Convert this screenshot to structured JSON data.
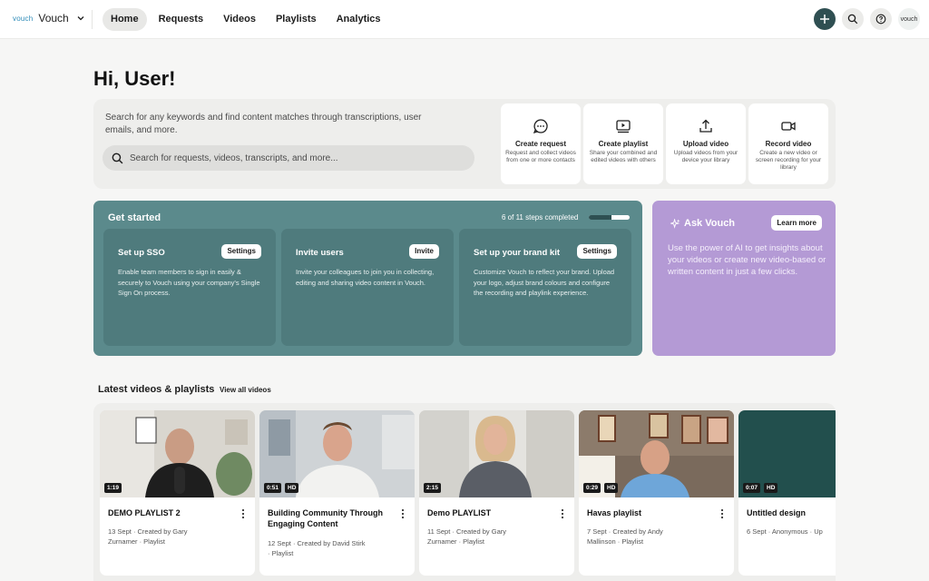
{
  "brand": {
    "logo_text": "vouch",
    "name": "Vouch"
  },
  "nav": {
    "items": [
      "Home",
      "Requests",
      "Videos",
      "Playlists",
      "Analytics"
    ],
    "active": "Home"
  },
  "user_avatar": "vouch",
  "greeting": "Hi, User!",
  "search": {
    "description": "Search for any keywords and find content matches through transcriptions, user emails, and more.",
    "placeholder": "Search for requests, videos, transcripts, and more..."
  },
  "actions": [
    {
      "title": "Create request",
      "desc": "Request and collect videos from one or more contacts",
      "icon": "chat-bubble-icon"
    },
    {
      "title": "Create playlist",
      "desc": "Share your combined and edited videos with others",
      "icon": "playlist-icon"
    },
    {
      "title": "Upload video",
      "desc": "Upload videos from your device your library",
      "icon": "upload-icon"
    },
    {
      "title": "Record video",
      "desc": "Create a new video or screen recording for your library",
      "icon": "camera-icon"
    }
  ],
  "get_started": {
    "title": "Get started",
    "progress_text": "6 of 11 steps completed",
    "progress": 0.545,
    "cards": [
      {
        "title": "Set up SSO",
        "button": "Settings",
        "desc": "Enable team members to sign in easily & securely to Vouch using your company's Single Sign On process."
      },
      {
        "title": "Invite users",
        "button": "Invite",
        "desc": "Invite your colleagues to join you in collecting, editing and sharing video content in Vouch."
      },
      {
        "title": "Set up your brand kit",
        "button": "Settings",
        "desc": "Customize Vouch to reflect your brand. Upload your logo, adjust brand colours and configure the recording and playlink experience."
      }
    ]
  },
  "ask_vouch": {
    "title": "Ask Vouch",
    "button": "Learn more",
    "desc": "Use the power of AI to get insights about your videos or create new video-based or written content in just a few clicks."
  },
  "latest": {
    "title": "Latest videos & playlists",
    "view_all": "View all videos",
    "videos": [
      {
        "title": "DEMO PLAYLIST 2",
        "meta1": "13 Sept · Created by Gary",
        "meta2": "Zurnamer · Playlist",
        "duration": "1:19",
        "hd": ""
      },
      {
        "title": "Building Community Through Engaging Content",
        "meta1": "12 Sept · Created by David Stirk",
        "meta2": "· Playlist",
        "duration": "0:51",
        "hd": "HD"
      },
      {
        "title": "Demo PLAYLIST",
        "meta1": "11 Sept · Created by Gary",
        "meta2": "Zurnamer · Playlist",
        "duration": "2:15",
        "hd": ""
      },
      {
        "title": "Havas playlist",
        "meta1": "7 Sept · Created by Andy",
        "meta2": "Mallinson · Playlist",
        "duration": "0:29",
        "hd": "HD"
      },
      {
        "title": "Untitled design",
        "meta1": "6 Sept · Anonymous · Up",
        "meta2": "",
        "duration": "0:07",
        "hd": "HD"
      }
    ]
  },
  "colors": {
    "accent_dark": "#2f4f52",
    "get_started_bg": "#5b8a8c",
    "ask_bg": "#b49ad5"
  }
}
